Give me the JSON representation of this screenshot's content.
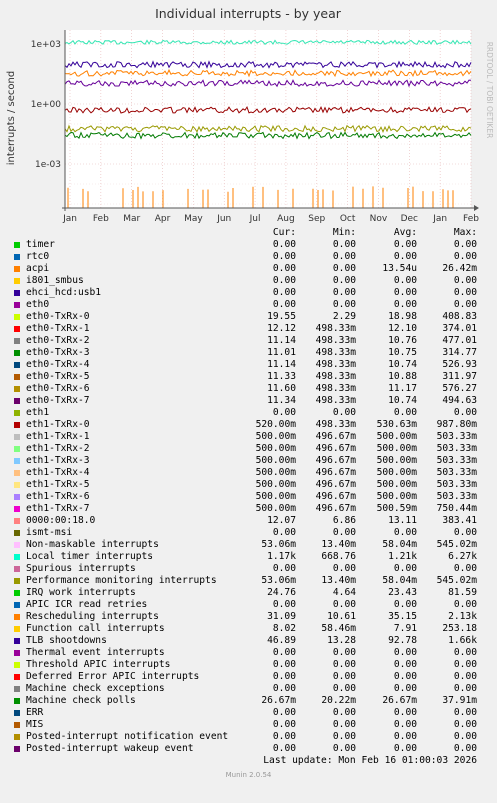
{
  "chart_data": {
    "type": "line",
    "title": "Individual interrupts - by year",
    "ylabel": "interrupts / second",
    "yscale": "log",
    "yticks": [
      "1e+03",
      "1e+00",
      "1e-03"
    ],
    "x_tick_labels": [
      "Jan",
      "Feb",
      "Mar",
      "Apr",
      "May",
      "Jun",
      "Jul",
      "Aug",
      "Sep",
      "Oct",
      "Nov",
      "Dec",
      "Jan",
      "Feb"
    ],
    "grid": true,
    "side_label": "RRDTOOL / TOBI OETIKER",
    "approx_levels": [
      {
        "name": "Local timer interrupts",
        "value": 1210,
        "color": "#33e6b3"
      },
      {
        "name": "eth0 / eth1 queues",
        "value": 11,
        "color": "#660099"
      },
      {
        "name": "TLB shootdowns",
        "value": 92.78,
        "color": "#330099"
      },
      {
        "name": "Rescheduling interrupts",
        "value": 35.15,
        "color": "#ff8000"
      },
      {
        "name": "eth1 queues",
        "value": 0.5,
        "color": "#990000"
      },
      {
        "name": "Non-maskable / Perf monitoring",
        "value": 0.058,
        "color": "#999900"
      },
      {
        "name": "Machine check polls",
        "value": 0.0267,
        "color": "#007a00"
      },
      {
        "name": "acpi",
        "value": 1.354e-05,
        "color": "#ff8000"
      }
    ]
  },
  "legend": {
    "headers": [
      "Cur:",
      "Min:",
      "Avg:",
      "Max:"
    ],
    "rows": [
      {
        "name": "timer",
        "color": "#00cc00",
        "cur": "0.00",
        "min": "0.00",
        "avg": "0.00",
        "max": "0.00"
      },
      {
        "name": "rtc0",
        "color": "#0066b3",
        "cur": "0.00",
        "min": "0.00",
        "avg": "0.00",
        "max": "0.00"
      },
      {
        "name": "acpi",
        "color": "#ff8000",
        "cur": "0.00",
        "min": "0.00",
        "avg": "13.54u",
        "max": "26.42m"
      },
      {
        "name": "i801_smbus",
        "color": "#ffcc00",
        "cur": "0.00",
        "min": "0.00",
        "avg": "0.00",
        "max": "0.00"
      },
      {
        "name": "ehci_hcd:usb1",
        "color": "#330099",
        "cur": "0.00",
        "min": "0.00",
        "avg": "0.00",
        "max": "0.00"
      },
      {
        "name": "eth0",
        "color": "#990099",
        "cur": "0.00",
        "min": "0.00",
        "avg": "0.00",
        "max": "0.00"
      },
      {
        "name": "eth0-TxRx-0",
        "color": "#ccff00",
        "cur": "19.55",
        "min": "2.29",
        "avg": "18.98",
        "max": "408.83"
      },
      {
        "name": "eth0-TxRx-1",
        "color": "#ff0000",
        "cur": "12.12",
        "min": "498.33m",
        "avg": "12.10",
        "max": "374.01"
      },
      {
        "name": "eth0-TxRx-2",
        "color": "#808080",
        "cur": "11.14",
        "min": "498.33m",
        "avg": "10.76",
        "max": "477.01"
      },
      {
        "name": "eth0-TxRx-3",
        "color": "#008f00",
        "cur": "11.01",
        "min": "498.33m",
        "avg": "10.75",
        "max": "314.77"
      },
      {
        "name": "eth0-TxRx-4",
        "color": "#00487d",
        "cur": "11.14",
        "min": "498.33m",
        "avg": "10.74",
        "max": "526.93"
      },
      {
        "name": "eth0-TxRx-5",
        "color": "#b35a00",
        "cur": "11.33",
        "min": "498.33m",
        "avg": "10.88",
        "max": "311.97"
      },
      {
        "name": "eth0-TxRx-6",
        "color": "#b38f00",
        "cur": "11.60",
        "min": "498.33m",
        "avg": "11.17",
        "max": "576.27"
      },
      {
        "name": "eth0-TxRx-7",
        "color": "#6b006b",
        "cur": "11.34",
        "min": "498.33m",
        "avg": "10.74",
        "max": "494.63"
      },
      {
        "name": "eth1",
        "color": "#8fb300",
        "cur": "0.00",
        "min": "0.00",
        "avg": "0.00",
        "max": "0.00"
      },
      {
        "name": "eth1-TxRx-0",
        "color": "#b30000",
        "cur": "520.00m",
        "min": "498.33m",
        "avg": "530.63m",
        "max": "987.80m"
      },
      {
        "name": "eth1-TxRx-1",
        "color": "#bebebe",
        "cur": "500.00m",
        "min": "496.67m",
        "avg": "500.00m",
        "max": "503.33m"
      },
      {
        "name": "eth1-TxRx-2",
        "color": "#80ff80",
        "cur": "500.00m",
        "min": "496.67m",
        "avg": "500.00m",
        "max": "503.33m"
      },
      {
        "name": "eth1-TxRx-3",
        "color": "#80c9ff",
        "cur": "500.00m",
        "min": "496.67m",
        "avg": "500.00m",
        "max": "503.33m"
      },
      {
        "name": "eth1-TxRx-4",
        "color": "#ffc080",
        "cur": "500.00m",
        "min": "496.67m",
        "avg": "500.00m",
        "max": "503.33m"
      },
      {
        "name": "eth1-TxRx-5",
        "color": "#ffe680",
        "cur": "500.00m",
        "min": "496.67m",
        "avg": "500.00m",
        "max": "503.33m"
      },
      {
        "name": "eth1-TxRx-6",
        "color": "#aa80ff",
        "cur": "500.00m",
        "min": "496.67m",
        "avg": "500.00m",
        "max": "503.33m"
      },
      {
        "name": "eth1-TxRx-7",
        "color": "#ee00cc",
        "cur": "500.00m",
        "min": "496.67m",
        "avg": "500.59m",
        "max": "750.44m"
      },
      {
        "name": "0000:00:18.0",
        "color": "#ff8080",
        "cur": "12.07",
        "min": "6.86",
        "avg": "13.11",
        "max": "383.41"
      },
      {
        "name": "ismt-msi",
        "color": "#666600",
        "cur": "0.00",
        "min": "0.00",
        "avg": "0.00",
        "max": "0.00"
      },
      {
        "name": "Non-maskable interrupts",
        "color": "#ffbfff",
        "cur": "53.06m",
        "min": "13.40m",
        "avg": "58.04m",
        "max": "545.02m"
      },
      {
        "name": "Local timer interrupts",
        "color": "#00ffcc",
        "cur": "1.17k",
        "min": "668.76",
        "avg": "1.21k",
        "max": "6.27k"
      },
      {
        "name": "Spurious interrupts",
        "color": "#cc6699",
        "cur": "0.00",
        "min": "0.00",
        "avg": "0.00",
        "max": "0.00"
      },
      {
        "name": "Performance monitoring interrupts",
        "color": "#999900",
        "cur": "53.06m",
        "min": "13.40m",
        "avg": "58.04m",
        "max": "545.02m"
      },
      {
        "name": "IRQ work interrupts",
        "color": "#00cc00",
        "cur": "24.76",
        "min": "4.64",
        "avg": "23.43",
        "max": "81.59"
      },
      {
        "name": "APIC ICR read retries",
        "color": "#0066b3",
        "cur": "0.00",
        "min": "0.00",
        "avg": "0.00",
        "max": "0.00"
      },
      {
        "name": "Rescheduling interrupts",
        "color": "#ff8000",
        "cur": "31.09",
        "min": "10.61",
        "avg": "35.15",
        "max": "2.13k"
      },
      {
        "name": "Function call interrupts",
        "color": "#ffcc00",
        "cur": "8.02",
        "min": "58.46m",
        "avg": "7.91",
        "max": "253.18"
      },
      {
        "name": "TLB shootdowns",
        "color": "#330099",
        "cur": "46.89",
        "min": "13.28",
        "avg": "92.78",
        "max": "1.66k"
      },
      {
        "name": "Thermal event interrupts",
        "color": "#990099",
        "cur": "0.00",
        "min": "0.00",
        "avg": "0.00",
        "max": "0.00"
      },
      {
        "name": "Threshold APIC interrupts",
        "color": "#ccff00",
        "cur": "0.00",
        "min": "0.00",
        "avg": "0.00",
        "max": "0.00"
      },
      {
        "name": "Deferred Error APIC interrupts",
        "color": "#ff0000",
        "cur": "0.00",
        "min": "0.00",
        "avg": "0.00",
        "max": "0.00"
      },
      {
        "name": "Machine check exceptions",
        "color": "#808080",
        "cur": "0.00",
        "min": "0.00",
        "avg": "0.00",
        "max": "0.00"
      },
      {
        "name": "Machine check polls",
        "color": "#008f00",
        "cur": "26.67m",
        "min": "20.22m",
        "avg": "26.67m",
        "max": "37.91m"
      },
      {
        "name": "ERR",
        "color": "#00487d",
        "cur": "0.00",
        "min": "0.00",
        "avg": "0.00",
        "max": "0.00"
      },
      {
        "name": "MIS",
        "color": "#b35a00",
        "cur": "0.00",
        "min": "0.00",
        "avg": "0.00",
        "max": "0.00"
      },
      {
        "name": "Posted-interrupt notification event",
        "color": "#b38f00",
        "cur": "0.00",
        "min": "0.00",
        "avg": "0.00",
        "max": "0.00"
      },
      {
        "name": "Posted-interrupt wakeup event",
        "color": "#6b006b",
        "cur": "0.00",
        "min": "0.00",
        "avg": "0.00",
        "max": "0.00"
      }
    ]
  },
  "footer": {
    "last_update": "Last update: Mon Feb 16 01:00:03 2026",
    "version": "Munin 2.0.54"
  }
}
